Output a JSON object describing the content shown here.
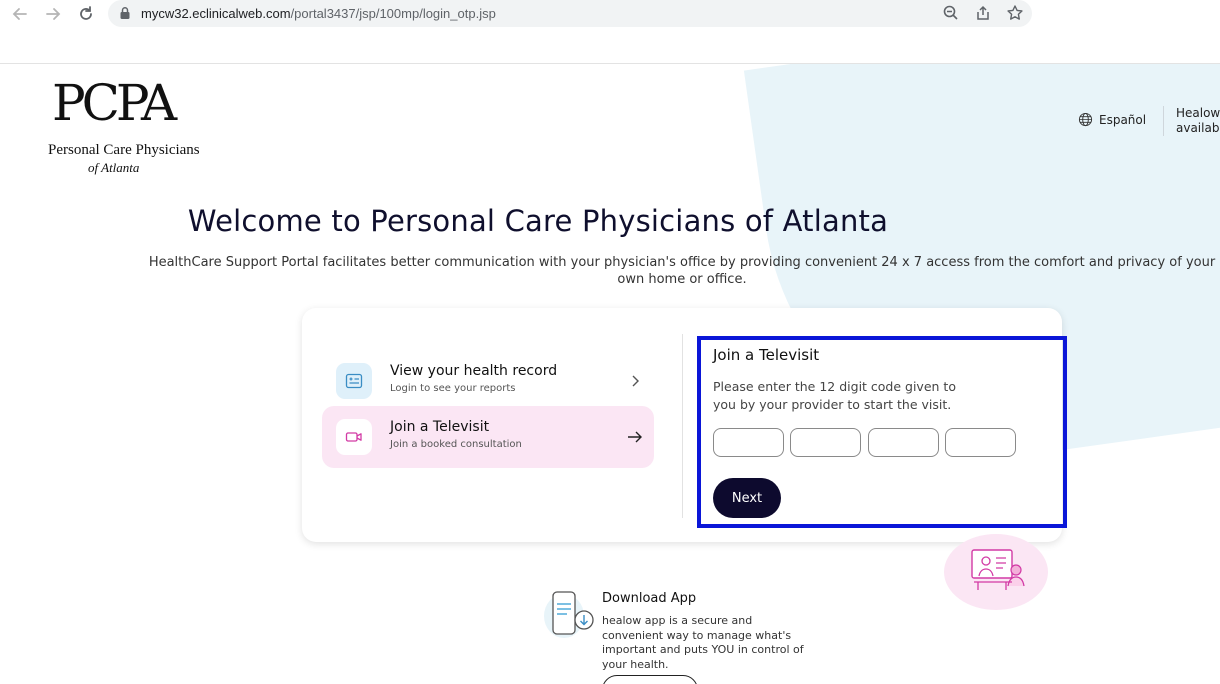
{
  "browser": {
    "url_host": "mycw32.eclinicalweb.com",
    "url_path": "/portal3437/jsp/100mp/login_otp.jsp"
  },
  "logo": {
    "mark": "PCPA",
    "line1": "Personal Care Physicians",
    "line2": "of Atlanta"
  },
  "header": {
    "language_label": "Español",
    "healow_text_line1": "Healow",
    "healow_text_line2": "availab"
  },
  "hero": {
    "title": "Welcome to Personal Care Physicians of Atlanta",
    "description": "HealthCare Support Portal facilitates better communication with your physician's office by providing convenient 24 x 7 access from the comfort and privacy of your own home or office."
  },
  "options": [
    {
      "title": "View your health record",
      "subtitle": "Login to see your reports"
    },
    {
      "title": "Join a Televisit",
      "subtitle": "Join a booked consultation"
    }
  ],
  "televisit": {
    "title": "Join a Televisit",
    "description": "Please enter the 12 digit code given to you by your provider to start the visit.",
    "code_values": [
      "",
      "",
      "",
      ""
    ],
    "next_label": "Next"
  },
  "download": {
    "title": "Download App",
    "description": "healow app is a secure and convenient way to manage what's important and puts YOU in control of your health."
  },
  "colors": {
    "accent_dark": "#0d0a2e",
    "active_option_bg": "#fbe6f4",
    "highlight_border": "#0a16d8",
    "bg_blob": "#e8f4f9"
  }
}
